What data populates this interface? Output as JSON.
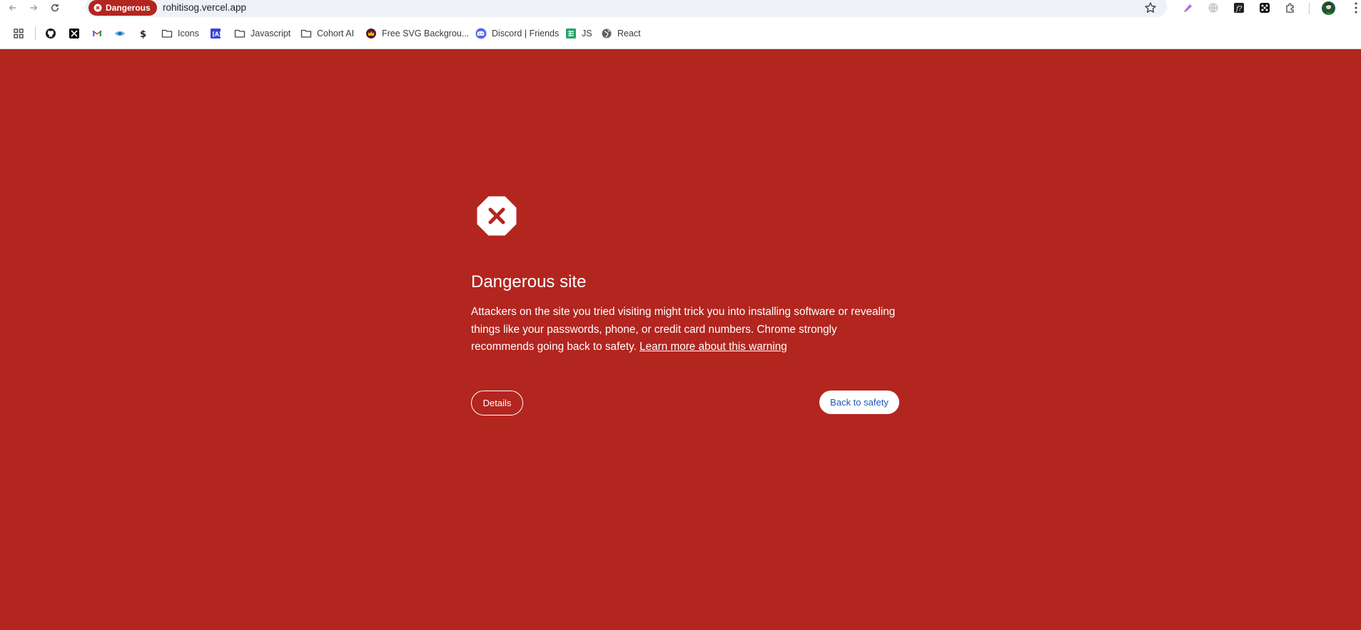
{
  "toolbar": {
    "back_icon": "arrow-left-icon",
    "forward_icon": "arrow-right-icon",
    "reload_icon": "reload-icon",
    "security_chip_label": "Dangerous",
    "url": "rohitisog.vercel.app",
    "bookmark_star_icon": "star-icon",
    "extension_icons": [
      "gradient-pen-icon",
      "globe-icon",
      "fx-icon",
      "dice-icon",
      "puzzle-icon"
    ],
    "menu_icon": "kebab-menu-icon"
  },
  "bookmarks": [
    {
      "label": "",
      "icon": "apps-grid-icon"
    },
    {
      "label": "",
      "icon": "github-icon"
    },
    {
      "label": "",
      "icon": "x-icon"
    },
    {
      "label": "",
      "icon": "gmail-icon"
    },
    {
      "label": "",
      "icon": "eye-icon"
    },
    {
      "label": "",
      "icon": "dollar-icon"
    },
    {
      "label": "Icons",
      "icon": "folder-icon"
    },
    {
      "label": "",
      "icon": "ai-box-icon"
    },
    {
      "label": "Javascript",
      "icon": "folder-icon"
    },
    {
      "label": "Cohort AI",
      "icon": "folder-icon"
    },
    {
      "label": "Free SVG Backgrou...",
      "icon": "crown-icon"
    },
    {
      "label": "Discord | Friends",
      "icon": "discord-icon"
    },
    {
      "label": "JS",
      "icon": "sheet-icon"
    },
    {
      "label": "React",
      "icon": "globe-icon"
    }
  ],
  "interstitial": {
    "title": "Dangerous site",
    "body": "Attackers on the site you tried visiting might trick you into installing software or revealing things like your passwords, phone, or credit card numbers. Chrome strongly recommends going back to safety.",
    "learn_more": "Learn more about this warning",
    "details_button": "Details",
    "back_button": "Back to safety",
    "background_color": "#b3251f",
    "button_text_color": "#1a57b5"
  }
}
